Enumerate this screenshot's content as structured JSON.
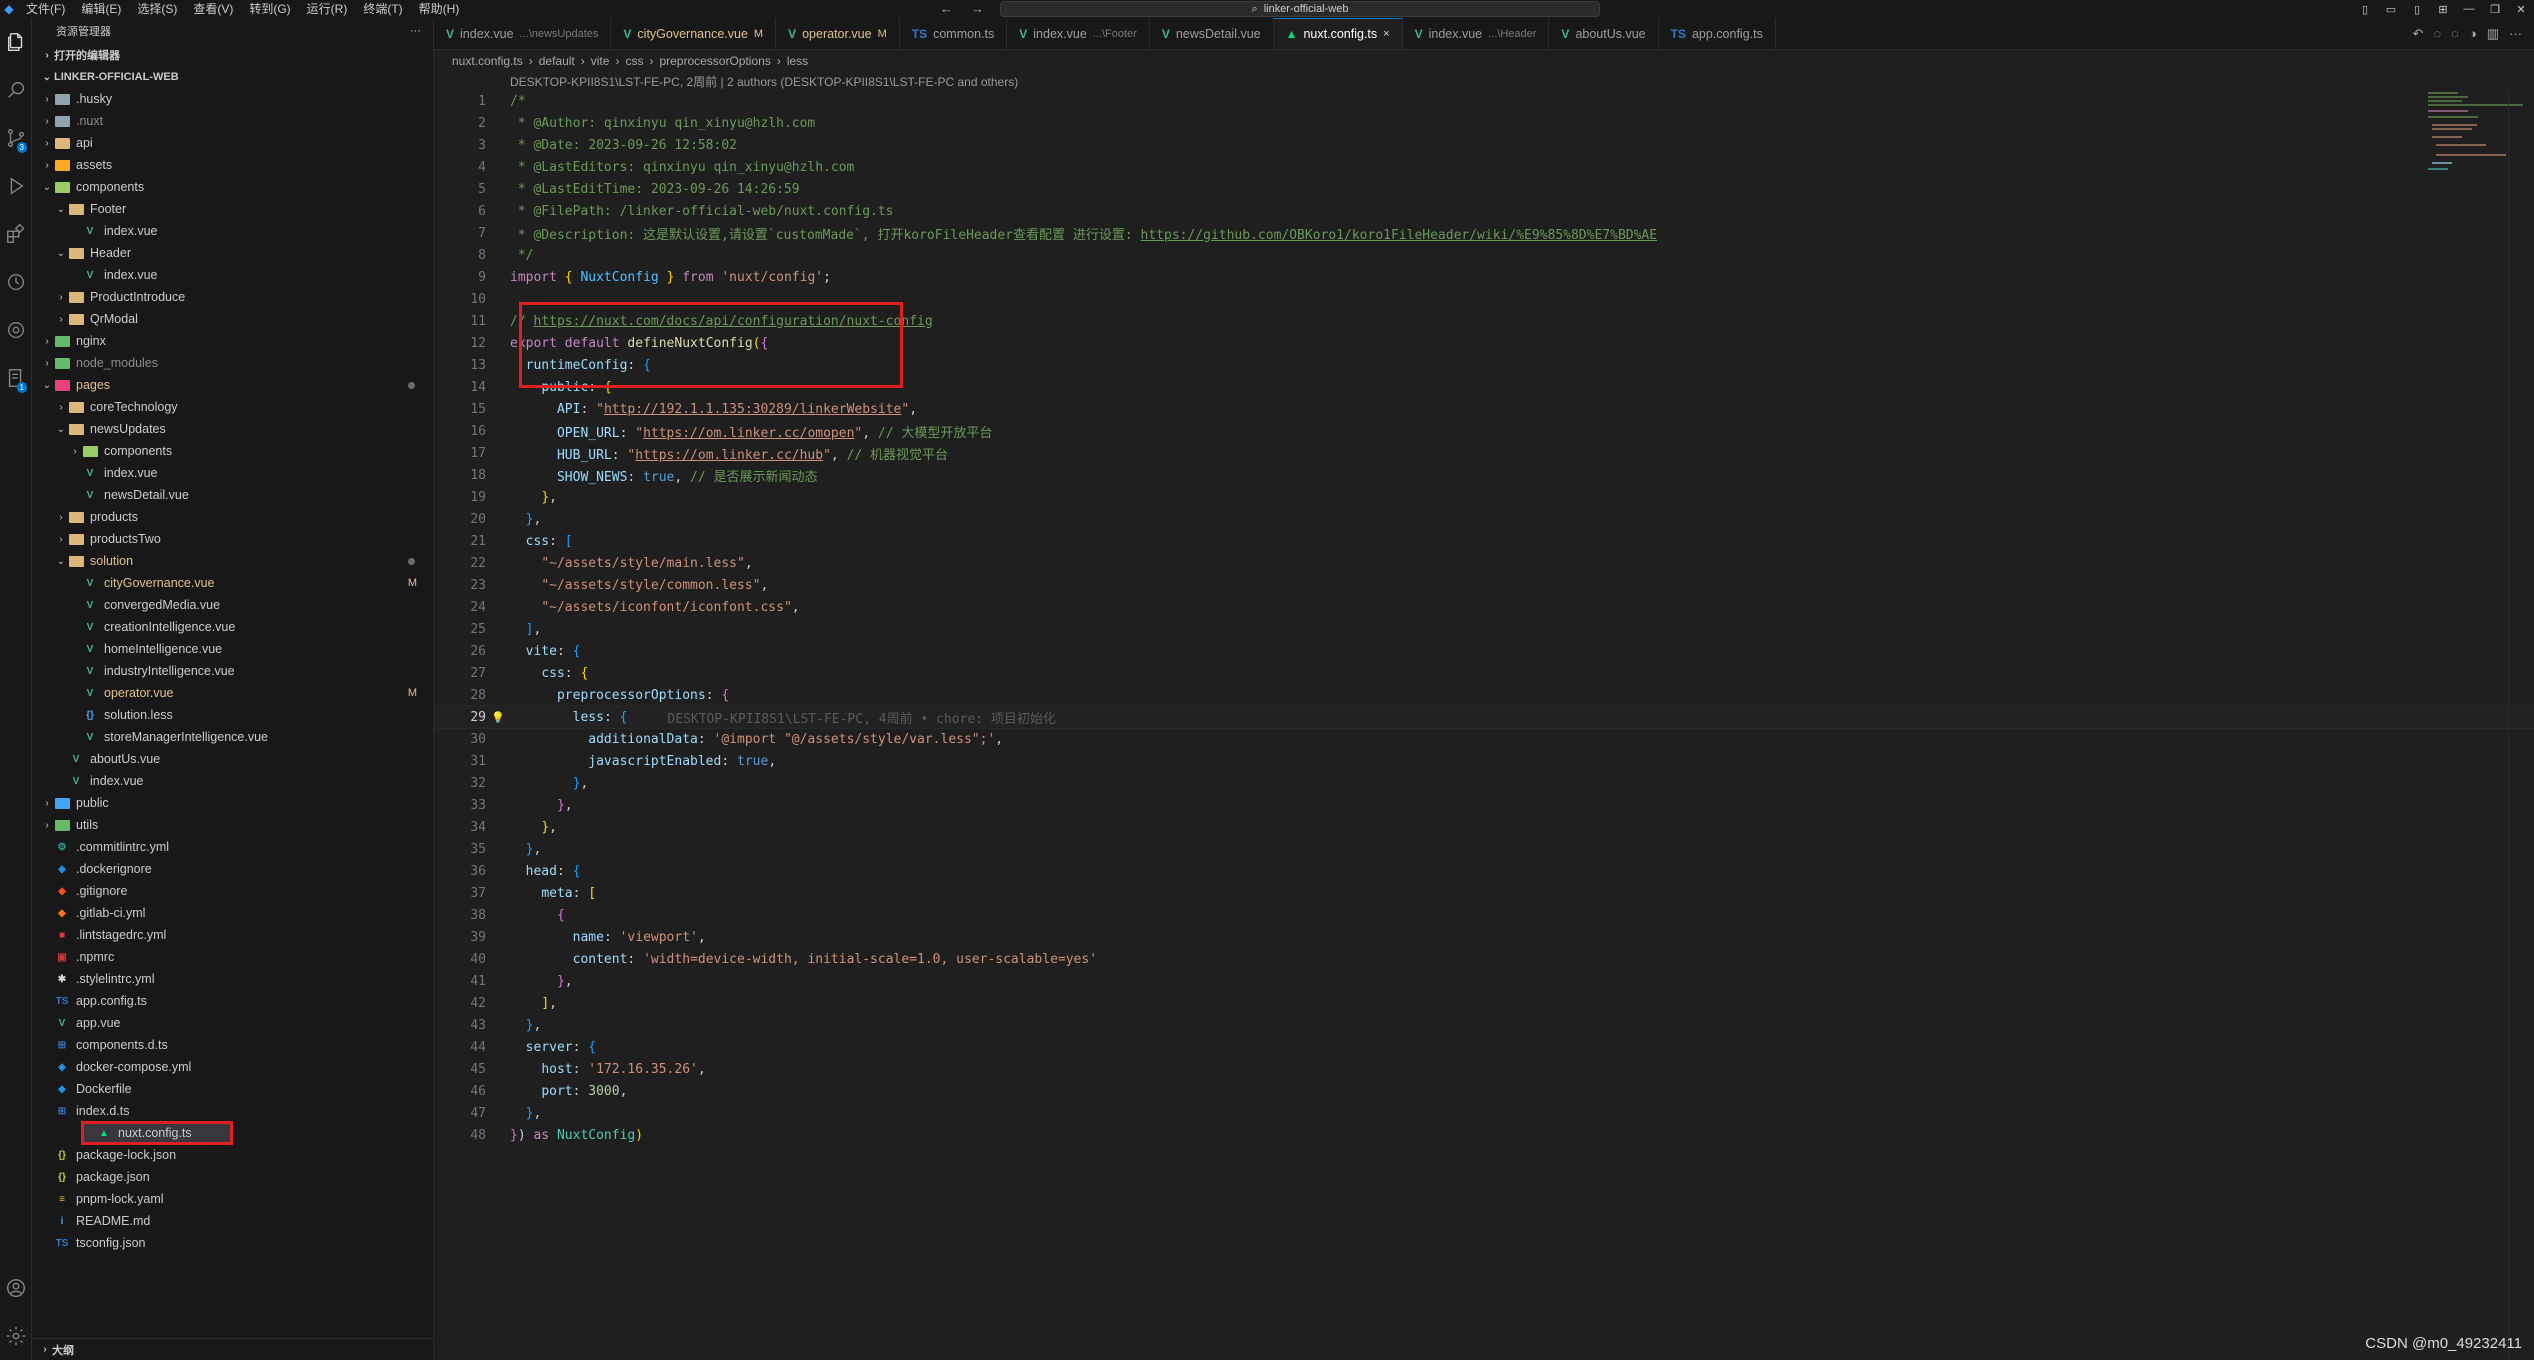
{
  "titlebar": {
    "menus": [
      "文件(F)",
      "编辑(E)",
      "选择(S)",
      "查看(V)",
      "转到(G)",
      "运行(R)",
      "终端(T)",
      "帮助(H)"
    ],
    "search_text": "linker-official-web"
  },
  "sidebar": {
    "title": "资源管理器",
    "more": "···",
    "section_open_editors": "打开的编辑器",
    "project": "LINKER-OFFICIAL-WEB",
    "items": [
      {
        "label": ".husky",
        "depth": 1,
        "kind": "folder",
        "chev": ">",
        "color": "grey"
      },
      {
        "label": ".nuxt",
        "depth": 1,
        "kind": "folder",
        "chev": ">",
        "color": "grey",
        "dim": true
      },
      {
        "label": "api",
        "depth": 1,
        "kind": "folder",
        "chev": ">",
        "color": "yellow"
      },
      {
        "label": "assets",
        "depth": 1,
        "kind": "folder",
        "chev": ">",
        "color": "orange"
      },
      {
        "label": "components",
        "depth": 1,
        "kind": "folder",
        "chev": "v",
        "color": "lime"
      },
      {
        "label": "Footer",
        "depth": 2,
        "kind": "folder",
        "chev": "v",
        "color": "yellow"
      },
      {
        "label": "index.vue",
        "depth": 3,
        "kind": "vue"
      },
      {
        "label": "Header",
        "depth": 2,
        "kind": "folder",
        "chev": "v",
        "color": "yellow"
      },
      {
        "label": "index.vue",
        "depth": 3,
        "kind": "vue"
      },
      {
        "label": "ProductIntroduce",
        "depth": 2,
        "kind": "folder",
        "chev": ">",
        "color": "yellow"
      },
      {
        "label": "QrModal",
        "depth": 2,
        "kind": "folder",
        "chev": ">",
        "color": "yellow"
      },
      {
        "label": "nginx",
        "depth": 1,
        "kind": "folder",
        "chev": ">",
        "color": "green"
      },
      {
        "label": "node_modules",
        "depth": 1,
        "kind": "folder",
        "chev": ">",
        "color": "green",
        "dim": true
      },
      {
        "label": "pages",
        "depth": 1,
        "kind": "folder",
        "chev": "v",
        "color": "pink",
        "mod": true,
        "dot": true
      },
      {
        "label": "coreTechnology",
        "depth": 2,
        "kind": "folder",
        "chev": ">",
        "color": "yellow"
      },
      {
        "label": "newsUpdates",
        "depth": 2,
        "kind": "folder",
        "chev": "v",
        "color": "yellow"
      },
      {
        "label": "components",
        "depth": 3,
        "kind": "folder",
        "chev": ">",
        "color": "lime"
      },
      {
        "label": "index.vue",
        "depth": 3,
        "kind": "vue"
      },
      {
        "label": "newsDetail.vue",
        "depth": 3,
        "kind": "vue"
      },
      {
        "label": "products",
        "depth": 2,
        "kind": "folder",
        "chev": ">",
        "color": "yellow"
      },
      {
        "label": "productsTwo",
        "depth": 2,
        "kind": "folder",
        "chev": ">",
        "color": "yellow"
      },
      {
        "label": "solution",
        "depth": 2,
        "kind": "folder",
        "chev": "v",
        "color": "yellow",
        "mod": true,
        "dot": true
      },
      {
        "label": "cityGovernance.vue",
        "depth": 3,
        "kind": "vue",
        "mod": true,
        "status": "M"
      },
      {
        "label": "convergedMedia.vue",
        "depth": 3,
        "kind": "vue"
      },
      {
        "label": "creationIntelligence.vue",
        "depth": 3,
        "kind": "vue"
      },
      {
        "label": "homeIntelligence.vue",
        "depth": 3,
        "kind": "vue"
      },
      {
        "label": "industryIntelligence.vue",
        "depth": 3,
        "kind": "vue"
      },
      {
        "label": "operator.vue",
        "depth": 3,
        "kind": "vue",
        "mod": true,
        "status": "M"
      },
      {
        "label": "solution.less",
        "depth": 3,
        "kind": "less"
      },
      {
        "label": "storeManagerIntelligence.vue",
        "depth": 3,
        "kind": "vue"
      },
      {
        "label": "aboutUs.vue",
        "depth": 2,
        "kind": "vue"
      },
      {
        "label": "index.vue",
        "depth": 2,
        "kind": "vue"
      },
      {
        "label": "public",
        "depth": 1,
        "kind": "folder",
        "chev": ">",
        "color": "blue"
      },
      {
        "label": "utils",
        "depth": 1,
        "kind": "folder",
        "chev": ">",
        "color": "green"
      },
      {
        "label": ".commitlintrc.yml",
        "depth": 1,
        "kind": "cfg"
      },
      {
        "label": ".dockerignore",
        "depth": 1,
        "kind": "docker"
      },
      {
        "label": ".gitignore",
        "depth": 1,
        "kind": "git"
      },
      {
        "label": ".gitlab-ci.yml",
        "depth": 1,
        "kind": "gitlab"
      },
      {
        "label": ".lintstagedrc.yml",
        "depth": 1,
        "kind": "red"
      },
      {
        "label": ".npmrc",
        "depth": 1,
        "kind": "npm"
      },
      {
        "label": ".stylelintrc.yml",
        "depth": 1,
        "kind": "style"
      },
      {
        "label": "app.config.ts",
        "depth": 1,
        "kind": "ts"
      },
      {
        "label": "app.vue",
        "depth": 1,
        "kind": "vue"
      },
      {
        "label": "components.d.ts",
        "depth": 1,
        "kind": "dts"
      },
      {
        "label": "docker-compose.yml",
        "depth": 1,
        "kind": "docker"
      },
      {
        "label": "Dockerfile",
        "depth": 1,
        "kind": "docker"
      },
      {
        "label": "index.d.ts",
        "depth": 1,
        "kind": "dts"
      },
      {
        "label": "nuxt.config.ts",
        "depth": 1,
        "kind": "nuxt",
        "selected": true
      },
      {
        "label": "package-lock.json",
        "depth": 1,
        "kind": "json"
      },
      {
        "label": "package.json",
        "depth": 1,
        "kind": "json"
      },
      {
        "label": "pnpm-lock.yaml",
        "depth": 1,
        "kind": "yaml"
      },
      {
        "label": "README.md",
        "depth": 1,
        "kind": "info"
      },
      {
        "label": "tsconfig.json",
        "depth": 1,
        "kind": "tsjson"
      }
    ],
    "outline": "大纲"
  },
  "tabs": [
    {
      "name": "index.vue",
      "desc": "...\\newsUpdates",
      "icon": "V",
      "kind": "vue"
    },
    {
      "name": "cityGovernance.vue",
      "desc": "M",
      "icon": "V",
      "kind": "vue",
      "modified": true
    },
    {
      "name": "operator.vue",
      "desc": "M",
      "icon": "V",
      "kind": "vue",
      "modified": true
    },
    {
      "name": "common.ts",
      "desc": "",
      "icon": "TS",
      "kind": "ts"
    },
    {
      "name": "index.vue",
      "desc": "...\\Footer",
      "icon": "V",
      "kind": "vue"
    },
    {
      "name": "newsDetail.vue",
      "desc": "",
      "icon": "V",
      "kind": "vue"
    },
    {
      "name": "nuxt.config.ts",
      "desc": "×",
      "icon": "▲",
      "kind": "nuxt",
      "active": true
    },
    {
      "name": "index.vue",
      "desc": "...\\Header",
      "icon": "V",
      "kind": "vue"
    },
    {
      "name": "aboutUs.vue",
      "desc": "",
      "icon": "V",
      "kind": "vue"
    },
    {
      "name": "app.config.ts",
      "desc": "",
      "icon": "TS",
      "kind": "ts"
    }
  ],
  "breadcrumb": [
    "nuxt.config.ts",
    "default",
    "vite",
    "css",
    "preprocessorOptions",
    "less"
  ],
  "codelens": "DESKTOP-KPII8S1\\LST-FE-PC, 2周前 | 2 authors (DESKTOP-KPII8S1\\LST-FE-PC and others)",
  "code": {
    "current_line": 29,
    "blame": "DESKTOP-KPII8S1\\LST-FE-PC, 4周前 • chore: 项目初始化",
    "lines": [
      [
        [
          "c",
          "/*"
        ]
      ],
      [
        [
          "c",
          " * @Author: qinxinyu qin_xinyu@hzlh.com"
        ]
      ],
      [
        [
          "c",
          " * @Date: 2023-09-26 12:58:02"
        ]
      ],
      [
        [
          "c",
          " * @LastEditors: qinxinyu qin_xinyu@hzlh.com"
        ]
      ],
      [
        [
          "c",
          " * @LastEditTime: 2023-09-26 14:26:59"
        ]
      ],
      [
        [
          "c",
          " * @FilePath: /linker-official-web/nuxt.config.ts"
        ]
      ],
      [
        [
          "c",
          " * @Description: 这是默认设置,请设置`customMade`, 打开koroFileHeader查看配置 进行设置: "
        ],
        [
          "cu",
          "https://github.com/OBKoro1/koro1FileHeader/wiki/%E9%85%8D%E7%BD%AE"
        ]
      ],
      [
        [
          "c",
          " */"
        ]
      ],
      [
        [
          "k",
          "import"
        ],
        [
          "txt",
          " "
        ],
        [
          "b1",
          "{"
        ],
        [
          "txt",
          " "
        ],
        [
          "v",
          "NuxtConfig"
        ],
        [
          "txt",
          " "
        ],
        [
          "b1",
          "}"
        ],
        [
          "txt",
          " "
        ],
        [
          "k",
          "from"
        ],
        [
          "txt",
          " "
        ],
        [
          "s",
          "'nuxt/config'"
        ],
        [
          "txt",
          ";"
        ]
      ],
      [],
      [
        [
          "c",
          "// "
        ],
        [
          "cu",
          "https://nuxt.com/docs/api/configuration/nuxt-config"
        ]
      ],
      [
        [
          "k",
          "export"
        ],
        [
          "txt",
          " "
        ],
        [
          "k",
          "default"
        ],
        [
          "txt",
          " "
        ],
        [
          "f",
          "defineNuxtConfig"
        ],
        [
          "b1",
          "("
        ],
        [
          "b2",
          "{"
        ]
      ],
      [
        [
          "txt",
          "  "
        ],
        [
          "p",
          "runtimeConfig"
        ],
        [
          "txt",
          ": "
        ],
        [
          "b3",
          "{"
        ]
      ],
      [
        [
          "txt",
          "    "
        ],
        [
          "p",
          "public"
        ],
        [
          "txt",
          ": "
        ],
        [
          "b1",
          "{"
        ]
      ],
      [
        [
          "txt",
          "      "
        ],
        [
          "p",
          "API"
        ],
        [
          "txt",
          ": "
        ],
        [
          "s",
          "\""
        ],
        [
          "u",
          "http://192.1.1.135:30289/linkerWebsite"
        ],
        [
          "s",
          "\""
        ],
        [
          "txt",
          ","
        ]
      ],
      [
        [
          "txt",
          "      "
        ],
        [
          "p",
          "OPEN_URL"
        ],
        [
          "txt",
          ": "
        ],
        [
          "s",
          "\""
        ],
        [
          "u",
          "https://om.linker.cc/omopen"
        ],
        [
          "s",
          "\""
        ],
        [
          "txt",
          ", "
        ],
        [
          "c",
          "// 大模型开放平台"
        ]
      ],
      [
        [
          "txt",
          "      "
        ],
        [
          "p",
          "HUB_URL"
        ],
        [
          "txt",
          ": "
        ],
        [
          "s",
          "\""
        ],
        [
          "u",
          "https://om.linker.cc/hub"
        ],
        [
          "s",
          "\""
        ],
        [
          "txt",
          ", "
        ],
        [
          "c",
          "// 机器视觉平台"
        ]
      ],
      [
        [
          "txt",
          "      "
        ],
        [
          "p",
          "SHOW_NEWS"
        ],
        [
          "txt",
          ": "
        ],
        [
          "kb",
          "true"
        ],
        [
          "txt",
          ", "
        ],
        [
          "c",
          "// 是否展示新闻动态"
        ]
      ],
      [
        [
          "txt",
          "    "
        ],
        [
          "b1",
          "}"
        ],
        [
          "txt",
          ","
        ]
      ],
      [
        [
          "txt",
          "  "
        ],
        [
          "b3",
          "}"
        ],
        [
          "txt",
          ","
        ]
      ],
      [
        [
          "txt",
          "  "
        ],
        [
          "p",
          "css"
        ],
        [
          "txt",
          ": "
        ],
        [
          "b3",
          "["
        ]
      ],
      [
        [
          "txt",
          "    "
        ],
        [
          "s",
          "\"~/assets/style/main.less\""
        ],
        [
          "txt",
          ","
        ]
      ],
      [
        [
          "txt",
          "    "
        ],
        [
          "s",
          "\"~/assets/style/common.less\""
        ],
        [
          "txt",
          ","
        ]
      ],
      [
        [
          "txt",
          "    "
        ],
        [
          "s",
          "\"~/assets/iconfont/iconfont.css\""
        ],
        [
          "txt",
          ","
        ]
      ],
      [
        [
          "txt",
          "  "
        ],
        [
          "b3",
          "]"
        ],
        [
          "txt",
          ","
        ]
      ],
      [
        [
          "txt",
          "  "
        ],
        [
          "p",
          "vite"
        ],
        [
          "txt",
          ": "
        ],
        [
          "b3",
          "{"
        ]
      ],
      [
        [
          "txt",
          "    "
        ],
        [
          "p",
          "css"
        ],
        [
          "txt",
          ": "
        ],
        [
          "b1",
          "{"
        ]
      ],
      [
        [
          "txt",
          "      "
        ],
        [
          "p",
          "preprocessorOptions"
        ],
        [
          "txt",
          ": "
        ],
        [
          "b2",
          "{"
        ]
      ],
      [
        [
          "txt",
          "        "
        ],
        [
          "p",
          "less"
        ],
        [
          "txt",
          ": "
        ],
        [
          "b3",
          "{"
        ]
      ],
      [
        [
          "txt",
          "          "
        ],
        [
          "p",
          "additionalData"
        ],
        [
          "txt",
          ": "
        ],
        [
          "s",
          "'@import \"@/assets/style/var.less\";'"
        ],
        [
          "txt",
          ","
        ]
      ],
      [
        [
          "txt",
          "          "
        ],
        [
          "p",
          "javascriptEnabled"
        ],
        [
          "txt",
          ": "
        ],
        [
          "kb",
          "true"
        ],
        [
          "txt",
          ","
        ]
      ],
      [
        [
          "txt",
          "        "
        ],
        [
          "b3",
          "}"
        ],
        [
          "txt",
          ","
        ]
      ],
      [
        [
          "txt",
          "      "
        ],
        [
          "b2",
          "}"
        ],
        [
          "txt",
          ","
        ]
      ],
      [
        [
          "txt",
          "    "
        ],
        [
          "b1",
          "}"
        ],
        [
          "txt",
          ","
        ]
      ],
      [
        [
          "txt",
          "  "
        ],
        [
          "b3",
          "}"
        ],
        [
          "txt",
          ","
        ]
      ],
      [
        [
          "txt",
          "  "
        ],
        [
          "p",
          "head"
        ],
        [
          "txt",
          ": "
        ],
        [
          "b3",
          "{"
        ]
      ],
      [
        [
          "txt",
          "    "
        ],
        [
          "p",
          "meta"
        ],
        [
          "txt",
          ": "
        ],
        [
          "b1",
          "["
        ]
      ],
      [
        [
          "txt",
          "      "
        ],
        [
          "b2",
          "{"
        ]
      ],
      [
        [
          "txt",
          "        "
        ],
        [
          "p",
          "name"
        ],
        [
          "txt",
          ": "
        ],
        [
          "s",
          "'viewport'"
        ],
        [
          "txt",
          ","
        ]
      ],
      [
        [
          "txt",
          "        "
        ],
        [
          "p",
          "content"
        ],
        [
          "txt",
          ": "
        ],
        [
          "s",
          "'width=device-width, initial-scale=1.0, user-scalable=yes'"
        ]
      ],
      [
        [
          "txt",
          "      "
        ],
        [
          "b2",
          "}"
        ],
        [
          "txt",
          ","
        ]
      ],
      [
        [
          "txt",
          "    "
        ],
        [
          "b1",
          "]"
        ],
        [
          "txt",
          ","
        ]
      ],
      [
        [
          "txt",
          "  "
        ],
        [
          "b3",
          "}"
        ],
        [
          "txt",
          ","
        ]
      ],
      [
        [
          "txt",
          "  "
        ],
        [
          "p",
          "server"
        ],
        [
          "txt",
          ": "
        ],
        [
          "b3",
          "{"
        ]
      ],
      [
        [
          "txt",
          "    "
        ],
        [
          "p",
          "host"
        ],
        [
          "txt",
          ": "
        ],
        [
          "s",
          "'172.16.35.26'"
        ],
        [
          "txt",
          ","
        ]
      ],
      [
        [
          "txt",
          "    "
        ],
        [
          "p",
          "port"
        ],
        [
          "txt",
          ": "
        ],
        [
          "n",
          "3000"
        ],
        [
          "txt",
          ","
        ]
      ],
      [
        [
          "txt",
          "  "
        ],
        [
          "b3",
          "}"
        ],
        [
          "txt",
          ","
        ]
      ],
      [
        [
          "b2",
          "}"
        ],
        [
          "txt",
          ") "
        ],
        [
          "k",
          "as"
        ],
        [
          "txt",
          " "
        ],
        [
          "t",
          "NuxtConfig"
        ],
        [
          "b1",
          ")"
        ]
      ]
    ]
  },
  "watermark": "CSDN @m0_49232411"
}
